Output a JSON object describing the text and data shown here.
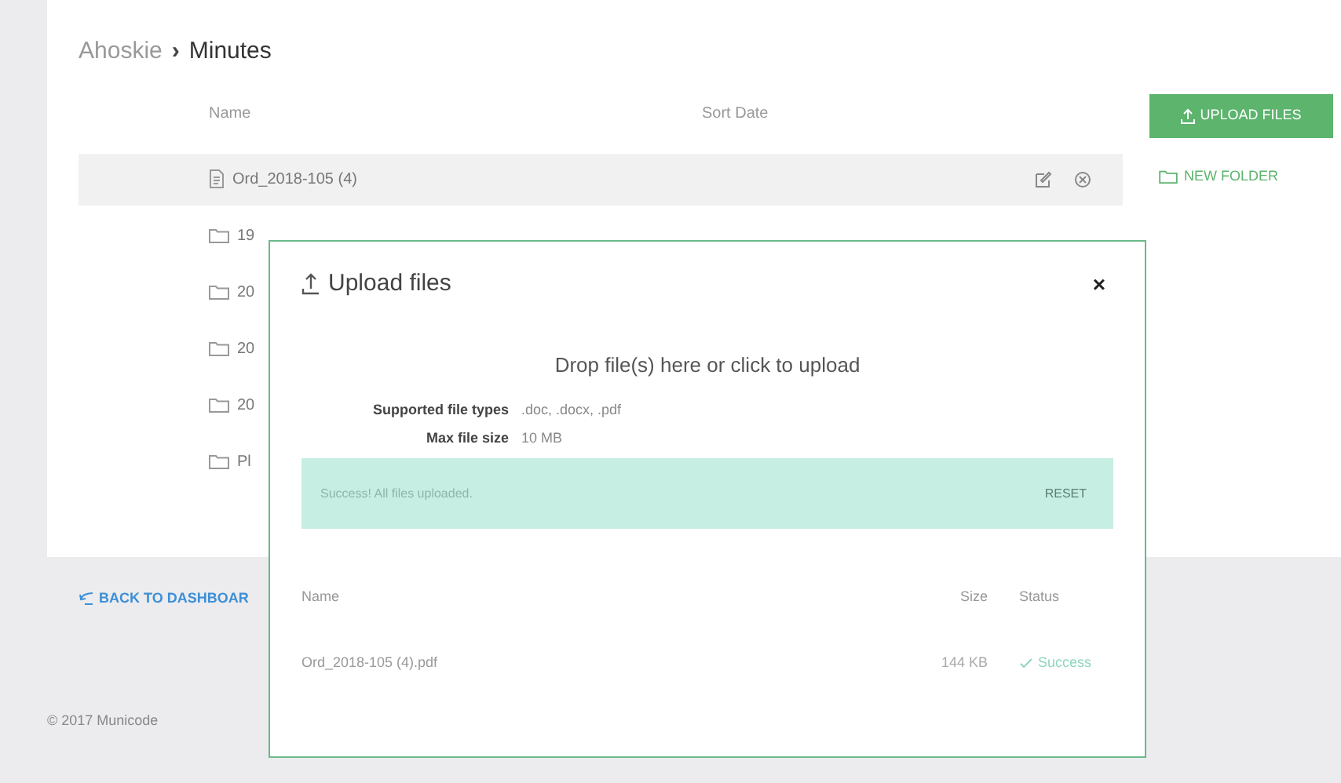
{
  "breadcrumb": {
    "parent": "Ahoskie",
    "separator": "›",
    "current": "Minutes"
  },
  "list": {
    "columns": [
      "Name",
      "Sort Date"
    ],
    "rows": [
      {
        "kind": "file",
        "name": "Ord_2018-105 (4)",
        "selected": true
      },
      {
        "kind": "folder",
        "name": "19",
        "selected": false
      },
      {
        "kind": "folder",
        "name": "20",
        "selected": false
      },
      {
        "kind": "folder",
        "name": "20",
        "selected": false
      },
      {
        "kind": "folder",
        "name": "20",
        "selected": false
      },
      {
        "kind": "folder",
        "name": "Pl",
        "selected": false
      }
    ]
  },
  "actions": {
    "upload": "UPLOAD FILES",
    "new_folder": "NEW FOLDER"
  },
  "back_link": "BACK TO DASHBOAR",
  "footer": "© 2017 Municode",
  "modal": {
    "title": "Upload files",
    "close": "×",
    "dropzone": "Drop file(s) here or click to upload",
    "info": [
      {
        "label": "Supported file types",
        "value": ".doc, .docx, .pdf"
      },
      {
        "label": "Max file size",
        "value": "10 MB"
      }
    ],
    "alert": {
      "message": "Success! All files uploaded.",
      "action": "RESET"
    },
    "table": {
      "columns": [
        "Name",
        "Size",
        "Status"
      ],
      "rows": [
        {
          "name": "Ord_2018-105 (4).pdf",
          "size": "144 KB",
          "status": "Success"
        }
      ]
    }
  }
}
